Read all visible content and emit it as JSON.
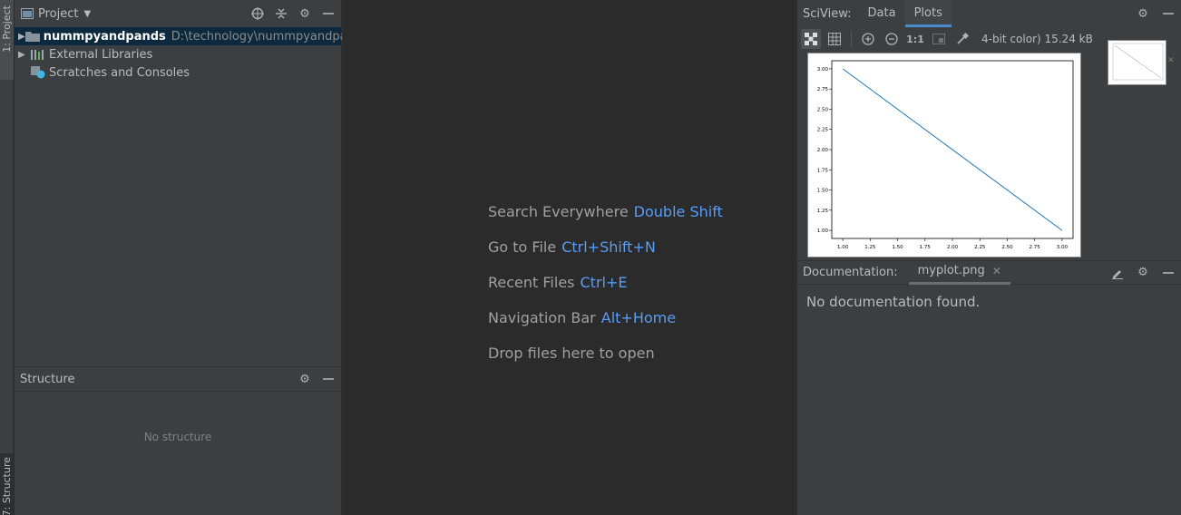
{
  "left_strip": {
    "project_tab": "1: Project",
    "structure_tab": "7: Structure"
  },
  "project": {
    "title": "Project",
    "items": [
      {
        "name": "nummpyandpands",
        "path": "D:\\technology\\nummpyandpands"
      },
      {
        "name": "External Libraries"
      },
      {
        "name": "Scratches and Consoles"
      }
    ]
  },
  "structure": {
    "title": "Structure",
    "empty": "No structure"
  },
  "editor": {
    "hints": [
      {
        "label": "Search Everywhere",
        "key": "Double Shift"
      },
      {
        "label": "Go to File",
        "key": "Ctrl+Shift+N"
      },
      {
        "label": "Recent Files",
        "key": "Ctrl+E"
      },
      {
        "label": "Navigation Bar",
        "key": "Alt+Home"
      },
      {
        "label": "Drop files here to open",
        "key": ""
      }
    ]
  },
  "sciview": {
    "title": "SciView:",
    "tabs": [
      "Data",
      "Plots"
    ],
    "active_tab": "Plots",
    "zoom_label": "1:1",
    "image_info": "4-bit color) 15.24 kB"
  },
  "chart_data": {
    "type": "line",
    "x": [
      1.0,
      3.0
    ],
    "series": [
      {
        "values": [
          3.0,
          1.0
        ],
        "color": "#1f77b4"
      }
    ],
    "xlim": [
      0.9,
      3.1
    ],
    "ylim": [
      0.9,
      3.1
    ],
    "xticks": [
      "1.00",
      "1.25",
      "1.50",
      "1.75",
      "2.00",
      "2.25",
      "2.50",
      "2.75",
      "3.00"
    ],
    "yticks": [
      "1.00",
      "1.25",
      "1.50",
      "1.75",
      "2.00",
      "2.25",
      "2.50",
      "2.75",
      "3.00"
    ],
    "grid": false
  },
  "documentation": {
    "title": "Documentation:",
    "tab": "myplot.png",
    "body": "No documentation found."
  },
  "colors": {
    "accent": "#589df6",
    "selection": "#0d293e",
    "panel": "#3c3f41",
    "editor": "#2b2b2b"
  }
}
